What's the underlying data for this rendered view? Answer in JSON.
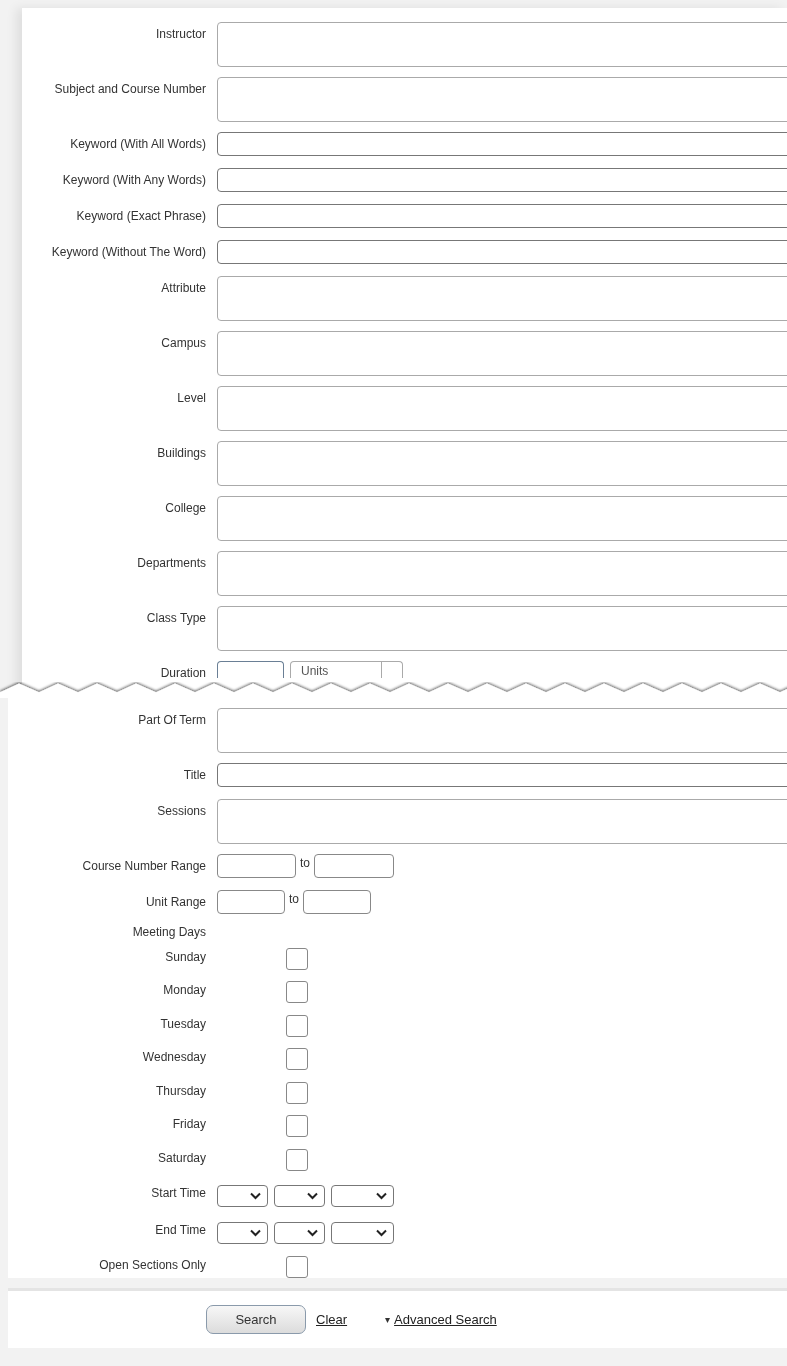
{
  "top_fields": [
    {
      "kind": "tall",
      "label": "Instructor"
    },
    {
      "kind": "tall",
      "label": "Subject and Course Number"
    },
    {
      "kind": "text",
      "label": "Keyword (With All Words)"
    },
    {
      "kind": "text",
      "label": "Keyword (With Any Words)"
    },
    {
      "kind": "text",
      "label": "Keyword (Exact Phrase)"
    },
    {
      "kind": "text",
      "label": "Keyword (Without The Word)"
    },
    {
      "kind": "tall",
      "label": "Attribute"
    },
    {
      "kind": "tall",
      "label": "Campus"
    },
    {
      "kind": "tall",
      "label": "Level"
    },
    {
      "kind": "tall",
      "label": "Buildings"
    },
    {
      "kind": "tall",
      "label": "College"
    },
    {
      "kind": "tall",
      "label": "Departments"
    },
    {
      "kind": "tall",
      "label": "Class Type"
    },
    {
      "kind": "duration",
      "label": "Duration",
      "unit": "Units"
    }
  ],
  "bottom_fields": [
    {
      "kind": "tall",
      "label": "Part Of Term"
    },
    {
      "kind": "text",
      "label": "Title"
    },
    {
      "kind": "tall",
      "label": "Sessions"
    },
    {
      "kind": "range",
      "label": "Course Number Range",
      "joiner": "to"
    },
    {
      "kind": "range",
      "label": "Unit Range",
      "joiner": "to"
    },
    {
      "kind": "heading",
      "label": "Meeting Days"
    },
    {
      "kind": "checkbox",
      "label": "Sunday",
      "checked": false
    },
    {
      "kind": "checkbox",
      "label": "Monday",
      "checked": false
    },
    {
      "kind": "checkbox",
      "label": "Tuesday",
      "checked": false
    },
    {
      "kind": "checkbox",
      "label": "Wednesday",
      "checked": false
    },
    {
      "kind": "checkbox",
      "label": "Thursday",
      "checked": false
    },
    {
      "kind": "checkbox",
      "label": "Friday",
      "checked": false
    },
    {
      "kind": "checkbox",
      "label": "Saturday",
      "checked": false
    },
    {
      "kind": "time",
      "label": "Start Time"
    },
    {
      "kind": "time",
      "label": "End Time"
    },
    {
      "kind": "checkbox",
      "label": "Open Sections Only",
      "checked": false
    }
  ],
  "actions": {
    "search": "Search",
    "clear": "Clear",
    "advanced_icon": "▾",
    "advanced": "Advanced Search"
  }
}
